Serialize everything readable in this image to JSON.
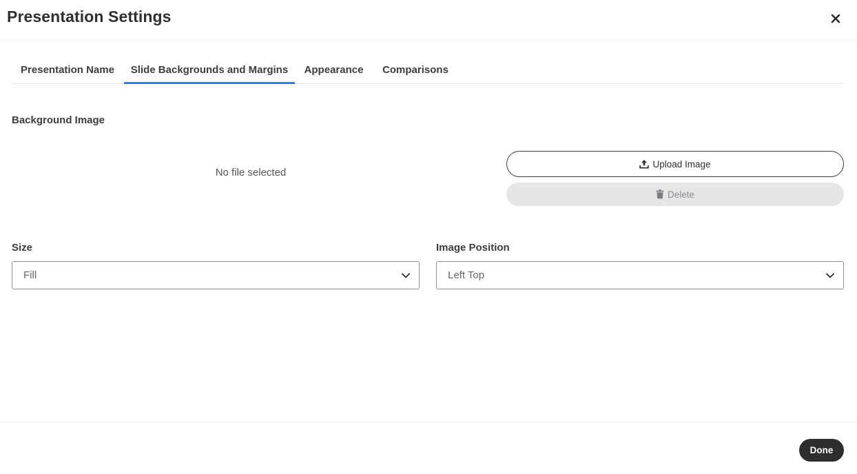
{
  "dialog": {
    "title": "Presentation Settings"
  },
  "tabs": [
    {
      "label": "Presentation Name",
      "active": false
    },
    {
      "label": "Slide Backgrounds and Margins",
      "active": true
    },
    {
      "label": "Appearance",
      "active": false
    },
    {
      "label": "Comparisons",
      "active": false
    }
  ],
  "background_image": {
    "label": "Background Image",
    "status": "No file selected",
    "upload_label": "Upload Image",
    "delete_label": "Delete"
  },
  "size": {
    "label": "Size",
    "selected": "Fill"
  },
  "image_position": {
    "label": "Image Position",
    "selected": "Left Top"
  },
  "footer": {
    "done_label": "Done"
  },
  "icons": {
    "close": "close-icon",
    "upload": "upload-icon",
    "delete": "trash-icon",
    "dropdown": "chevron-down-icon"
  },
  "colors": {
    "accent": "#3b78d8",
    "done_bg": "#2e2e31",
    "delete_bg": "#e6e6e8"
  }
}
